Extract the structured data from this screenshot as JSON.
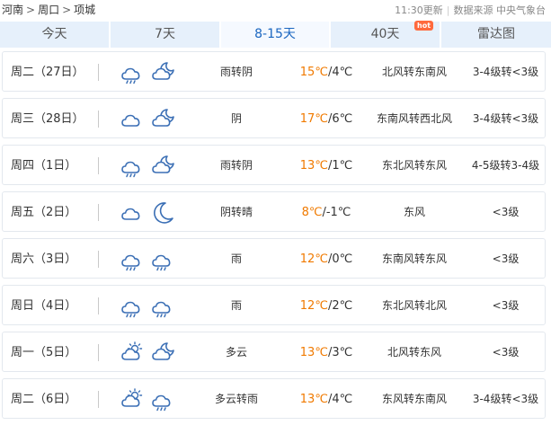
{
  "breadcrumb": {
    "province": "河南",
    "city": "周口",
    "county": "项城",
    "separator": ">"
  },
  "meta": {
    "update_time": "11:30更新",
    "source": "数据来源 中央气象台"
  },
  "tabs": [
    {
      "label": "今天",
      "active": false
    },
    {
      "label": "7天",
      "active": false
    },
    {
      "label": "8-15天",
      "active": true
    },
    {
      "label": "40天",
      "active": false,
      "badge": "hot"
    },
    {
      "label": "雷达图",
      "active": false
    }
  ],
  "colors": {
    "tab_bg": "#e6f0fb",
    "active_tab_text": "#1a66c0",
    "high_temp": "#f07a00",
    "icon_stroke": "#3b6fb5",
    "hot_badge": "#ff6a3d"
  },
  "days": [
    {
      "date": "周二（27日）",
      "icons": [
        "cloud-rain-icon",
        "cloud-moon-icon"
      ],
      "condition": "雨转阴",
      "high": "15℃",
      "low": "4℃",
      "wind": "北风转东南风",
      "level": "3-4级转<3级"
    },
    {
      "date": "周三（28日）",
      "icons": [
        "cloud-icon",
        "cloud-moon-icon"
      ],
      "condition": "阴",
      "high": "17℃",
      "low": "6℃",
      "wind": "东南风转西北风",
      "level": "3-4级转<3级"
    },
    {
      "date": "周四（1日）",
      "icons": [
        "cloud-rain-icon",
        "cloud-moon-icon"
      ],
      "condition": "雨转阴",
      "high": "13℃",
      "low": "1℃",
      "wind": "东北风转东风",
      "level": "4-5级转3-4级"
    },
    {
      "date": "周五（2日）",
      "icons": [
        "cloud-icon",
        "moon-icon"
      ],
      "condition": "阴转晴",
      "high": "8℃",
      "low": "-1℃",
      "wind": "东风",
      "level": "<3级"
    },
    {
      "date": "周六（3日）",
      "icons": [
        "cloud-rain-icon",
        "cloud-rain-icon"
      ],
      "condition": "雨",
      "high": "12℃",
      "low": "0℃",
      "wind": "东南风转东风",
      "level": "<3级"
    },
    {
      "date": "周日（4日）",
      "icons": [
        "cloud-rain-icon",
        "cloud-rain-icon"
      ],
      "condition": "雨",
      "high": "12℃",
      "low": "2℃",
      "wind": "东北风转北风",
      "level": "<3级"
    },
    {
      "date": "周一（5日）",
      "icons": [
        "cloud-sun-icon",
        "cloud-moon-icon"
      ],
      "condition": "多云",
      "high": "13℃",
      "low": "3℃",
      "wind": "北风转东风",
      "level": "<3级"
    },
    {
      "date": "周二（6日）",
      "icons": [
        "cloud-sun-icon",
        "cloud-rain-icon"
      ],
      "condition": "多云转雨",
      "high": "13℃",
      "low": "4℃",
      "wind": "东风转东南风",
      "level": "3-4级转<3级"
    }
  ]
}
